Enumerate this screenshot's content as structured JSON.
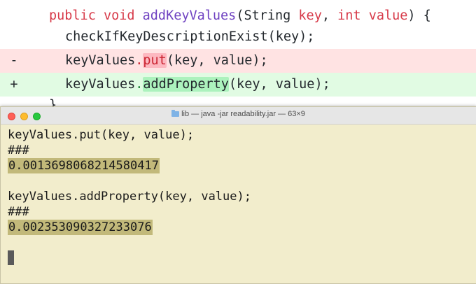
{
  "diff": {
    "lines": [
      {
        "type": "context",
        "marker": "",
        "parts": [
          "public void ",
          "addKeyValues",
          "(String ",
          "key",
          ", ",
          "int",
          " ",
          "value",
          ") {"
        ]
      },
      {
        "type": "context",
        "marker": "",
        "text": "checkIfKeyDescriptionExist(key);"
      },
      {
        "type": "removed",
        "marker": "-",
        "prefix": "keyValues",
        "dot": ".",
        "highlight": "put",
        "suffix": "(key, value);"
      },
      {
        "type": "added",
        "marker": "+",
        "prefix": "keyValues",
        "dot": ".",
        "highlight": "addProperty",
        "suffix": "(key, value);"
      },
      {
        "type": "context",
        "marker": "",
        "text": "}"
      }
    ]
  },
  "terminal": {
    "title": "lib — java -jar readability.jar — 63×9",
    "lines": [
      "keyValues.put(key, value);",
      "###",
      "0.0013698068214580417",
      "",
      "keyValues.addProperty(key, value);",
      "###",
      "0.002353090327233076",
      ""
    ]
  },
  "colors": {
    "removed_bg": "#ffe3e3",
    "added_bg": "#e1fbe3",
    "terminal_bg": "#f2edcc",
    "keyword": "#d73a49",
    "method": "#6f42c1"
  }
}
